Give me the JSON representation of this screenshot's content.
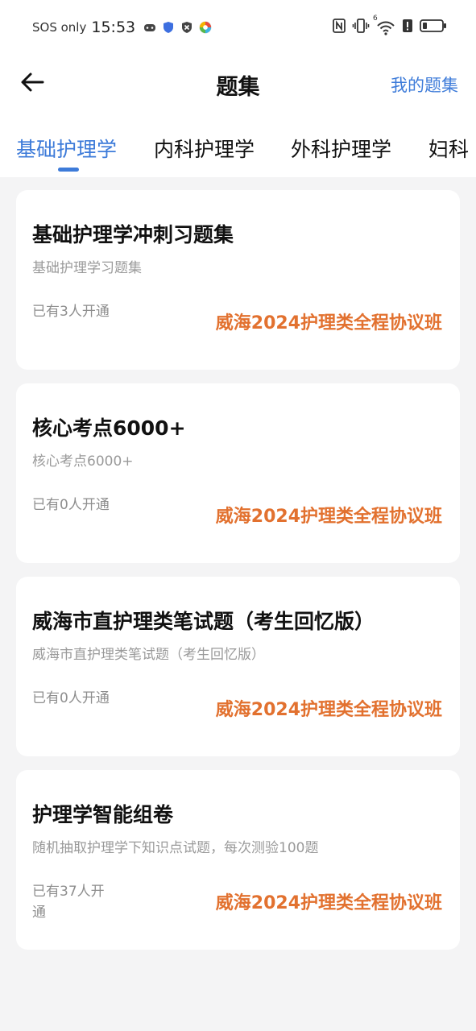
{
  "status_bar": {
    "carrier": "SOS only",
    "time": "15:53",
    "icons": [
      "game-icon",
      "shield-icon",
      "vpn-icon",
      "app-icon",
      "nfc-icon",
      "vibrate-icon",
      "wifi-icon",
      "alert-icon",
      "battery-icon"
    ],
    "wifi_badge": "6"
  },
  "header": {
    "title": "题集",
    "my_sets": "我的题集"
  },
  "tabs": [
    {
      "label": "基础护理学",
      "active": true
    },
    {
      "label": "内科护理学",
      "active": false
    },
    {
      "label": "外科护理学",
      "active": false
    },
    {
      "label": "妇科",
      "active": false
    }
  ],
  "cards": [
    {
      "title": "基础护理学冲刺习题集",
      "subtitle": "基础护理学习题集",
      "count": "已有3人开通",
      "class_name": "威海2024护理类全程协议班"
    },
    {
      "title": "核心考点6000+",
      "subtitle": "核心考点6000+",
      "count": "已有0人开通",
      "class_name": "威海2024护理类全程协议班"
    },
    {
      "title": "威海市直护理类笔试题（考生回忆版）",
      "subtitle": "威海市直护理类笔试题（考生回忆版）",
      "count": "已有0人开通",
      "class_name": "威海2024护理类全程协议班"
    },
    {
      "title": "护理学智能组卷",
      "subtitle": "随机抽取护理学下知识点试题，每次测验100题",
      "count": "已有37人开通",
      "class_name": "威海2024护理类全程协议班"
    }
  ],
  "colors": {
    "accent": "#3d7bd9",
    "class_orange": "#e2712f",
    "background": "#f4f4f5"
  }
}
